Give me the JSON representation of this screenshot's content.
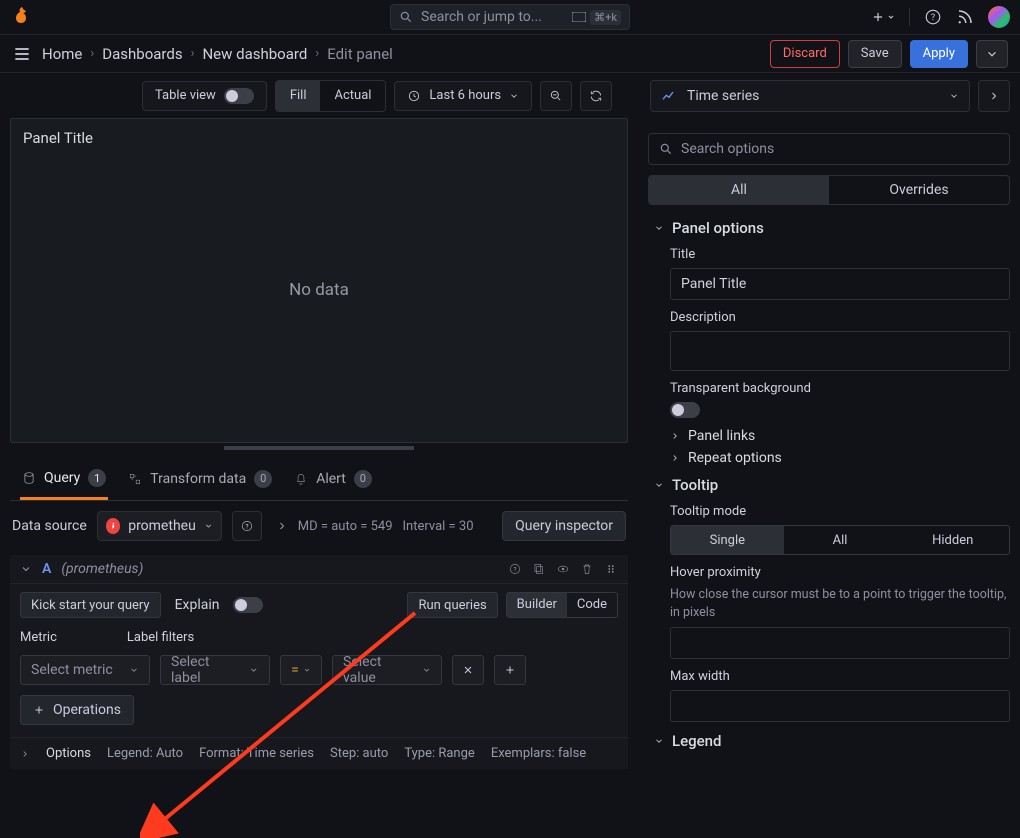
{
  "global": {
    "search_placeholder": "Search or jump to...",
    "kbd_hint": "⌘+k"
  },
  "breadcrumbs": {
    "items": [
      "Home",
      "Dashboards",
      "New dashboard",
      "Edit panel"
    ]
  },
  "actions": {
    "discard": "Discard",
    "save": "Save",
    "apply": "Apply"
  },
  "toolbar": {
    "table_view": "Table view",
    "fill": "Fill",
    "actual": "Actual",
    "time_range": "Last 6 hours",
    "vis_label": "Time series"
  },
  "panel": {
    "title": "Panel Title",
    "no_data": "No data"
  },
  "tabs": {
    "query": "Query",
    "query_count": "1",
    "transform": "Transform data",
    "transform_count": "0",
    "alert": "Alert",
    "alert_count": "0"
  },
  "datasource": {
    "label": "Data source",
    "selected": "prometheus",
    "meta_md": "MD = auto = 549",
    "meta_interval": "Interval = 30",
    "inspector": "Query inspector"
  },
  "query": {
    "letter": "A",
    "src": "(prometheus)",
    "kick_start": "Kick start your query",
    "explain": "Explain",
    "run": "Run queries",
    "builder": "Builder",
    "code": "Code",
    "metric_h": "Metric",
    "labels_h": "Label filters",
    "select_metric": "Select metric",
    "select_label": "Select label",
    "eq": "=",
    "select_value": "Select value",
    "operations": "Operations"
  },
  "query_options": {
    "label": "Options",
    "legend": "Legend: Auto",
    "format": "Format: Time series",
    "step": "Step: auto",
    "type": "Type: Range",
    "exemplars": "Exemplars: false"
  },
  "right": {
    "search_ph": "Search options",
    "tab_all": "All",
    "tab_overrides": "Overrides",
    "panel_options": "Panel options",
    "title_lbl": "Title",
    "title_val": "Panel Title",
    "desc_lbl": "Description",
    "transparent_lbl": "Transparent background",
    "panel_links": "Panel links",
    "repeat_options": "Repeat options",
    "tooltip": "Tooltip",
    "tooltip_mode": "Tooltip mode",
    "mode_single": "Single",
    "mode_all": "All",
    "mode_hidden": "Hidden",
    "hover_prox": "Hover proximity",
    "hover_desc": "How close the cursor must be to a point to trigger the tooltip, in pixels",
    "max_width": "Max width",
    "legend": "Legend"
  }
}
